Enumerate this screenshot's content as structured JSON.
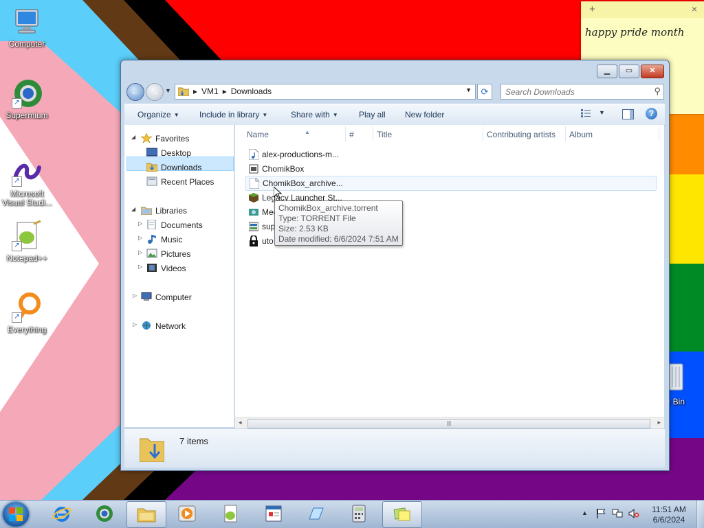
{
  "desktop": {
    "icons": [
      {
        "label": "Computer"
      },
      {
        "label": "Supermium"
      },
      {
        "label": "Microsoft Visual Studi..."
      },
      {
        "label": "Notepad++"
      },
      {
        "label": "Everything"
      }
    ],
    "recycle_bin_label": "cle Bin"
  },
  "sticky_note": {
    "add": "+",
    "close": "×",
    "text": "happy pride month"
  },
  "window": {
    "caption_min": "▁",
    "caption_max": "▭",
    "caption_close": "✕",
    "address": {
      "crumbs": [
        "VM1",
        "Downloads"
      ]
    },
    "search": {
      "placeholder": "Search Downloads"
    },
    "toolbar": {
      "organize": "Organize",
      "include_in_library": "Include in library",
      "share_with": "Share with",
      "play_all": "Play all",
      "new_folder": "New folder"
    },
    "nav": {
      "favorites": "Favorites",
      "desktop": "Desktop",
      "downloads": "Downloads",
      "recent_places": "Recent Places",
      "libraries": "Libraries",
      "documents": "Documents",
      "music": "Music",
      "pictures": "Pictures",
      "videos": "Videos",
      "computer": "Computer",
      "network": "Network"
    },
    "columns": {
      "name": "Name",
      "number": "#",
      "title": "Title",
      "contributing_artists": "Contributing artists",
      "album": "Album"
    },
    "files": [
      {
        "name": "alex-productions-m...",
        "type": "music"
      },
      {
        "name": "ChomikBox",
        "type": "app"
      },
      {
        "name": "ChomikBox_archive...",
        "type": "torrent"
      },
      {
        "name": "Legacy Launcher St...",
        "type": "minecraft"
      },
      {
        "name": "Med",
        "type": "media"
      },
      {
        "name": "sup",
        "type": "installer"
      },
      {
        "name": "uto",
        "type": "lock"
      }
    ],
    "tooltip": {
      "name": "ChomikBox_archive.torrent",
      "type": "Type: TORRENT File",
      "size": "Size: 2.53 KB",
      "date": "Date modified: 6/6/2024 7:51 AM"
    },
    "status": {
      "item_count": "7 items"
    }
  },
  "taskbar": {
    "clock_time": "11:51 AM",
    "clock_date": "6/6/2024"
  }
}
